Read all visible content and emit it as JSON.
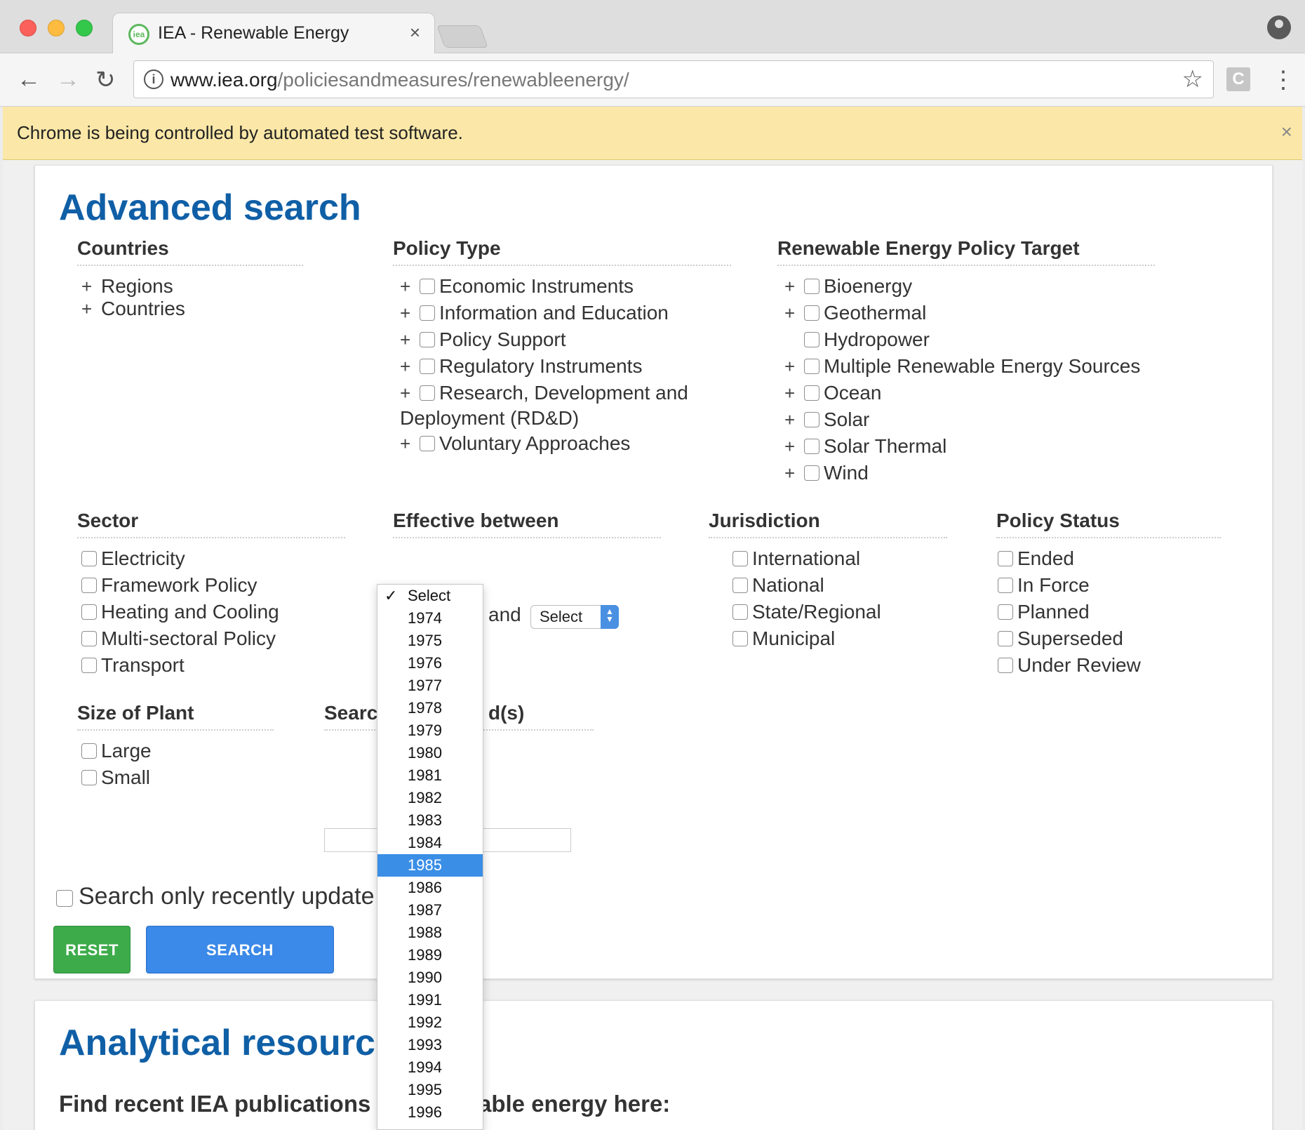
{
  "browser": {
    "tab_title": "IEA - Renewable Energy",
    "tab_close": "×",
    "favicon_text": "iea",
    "url_domain": "www.iea.org",
    "url_path": "/policiesandmeasures/renewableenergy/",
    "extension_label": "C",
    "infobar_text": "Chrome is being controlled by automated test software.",
    "infobar_close": "×"
  },
  "advanced": {
    "title": "Advanced search",
    "countries": {
      "heading": "Countries",
      "items": [
        "Regions",
        "Countries"
      ]
    },
    "policy_type": {
      "heading": "Policy Type",
      "items": [
        "Economic Instruments",
        "Information and Education",
        "Policy Support",
        "Regulatory Instruments",
        "Research, Development and",
        "Deployment (RD&D)",
        "Voluntary Approaches"
      ]
    },
    "target": {
      "heading": "Renewable Energy Policy Target",
      "items": [
        "Bioenergy",
        "Geothermal",
        "Hydropower",
        "Multiple Renewable Energy Sources",
        "Ocean",
        "Solar",
        "Solar Thermal",
        "Wind"
      ]
    },
    "sector": {
      "heading": "Sector",
      "items": [
        "Electricity",
        "Framework Policy",
        "Heating and Cooling",
        "Multi-sectoral Policy",
        "Transport"
      ]
    },
    "effective": {
      "heading": "Effective between",
      "and_label": "and",
      "to_value": "Select"
    },
    "jurisdiction": {
      "heading": "Jurisdiction",
      "items": [
        "International",
        "National",
        "State/Regional",
        "Municipal"
      ]
    },
    "status": {
      "heading": "Policy Status",
      "items": [
        "Ended",
        "In Force",
        "Planned",
        "Superseded",
        "Under Review"
      ]
    },
    "plant": {
      "heading": "Size of Plant",
      "items": [
        "Large",
        "Small"
      ]
    },
    "keyword": {
      "heading_left": "Search",
      "heading_right": "d(s)"
    },
    "recent_label": "Search only recently update",
    "reset_label": "RESET",
    "search_label": "SEARCH"
  },
  "analytical": {
    "title": "Analytical resource",
    "subtitle_left": "Find recent IEA publications",
    "subtitle_right": "able energy here:"
  },
  "dropdown": {
    "checkmark": "✓",
    "selected_index": 12,
    "options": [
      "Select",
      "1974",
      "1975",
      "1976",
      "1977",
      "1978",
      "1979",
      "1980",
      "1981",
      "1982",
      "1983",
      "1984",
      "1985",
      "1986",
      "1987",
      "1988",
      "1989",
      "1990",
      "1991",
      "1992",
      "1993",
      "1994",
      "1995",
      "1996"
    ]
  },
  "icons": {
    "back": "back-arrow-icon",
    "forward": "forward-arrow-icon",
    "reload": "reload-icon",
    "info": "info-icon",
    "star": "bookmark-star-icon",
    "menu": "kebab-menu-icon",
    "profile": "profile-icon",
    "plus": "expand-plus-icon"
  },
  "colors": {
    "heading_blue": "#0f5fa6",
    "reset_green": "#3dab4a",
    "search_blue": "#3b89e8",
    "infobar": "#fbe8a8",
    "highlight": "#3a8ee6"
  }
}
